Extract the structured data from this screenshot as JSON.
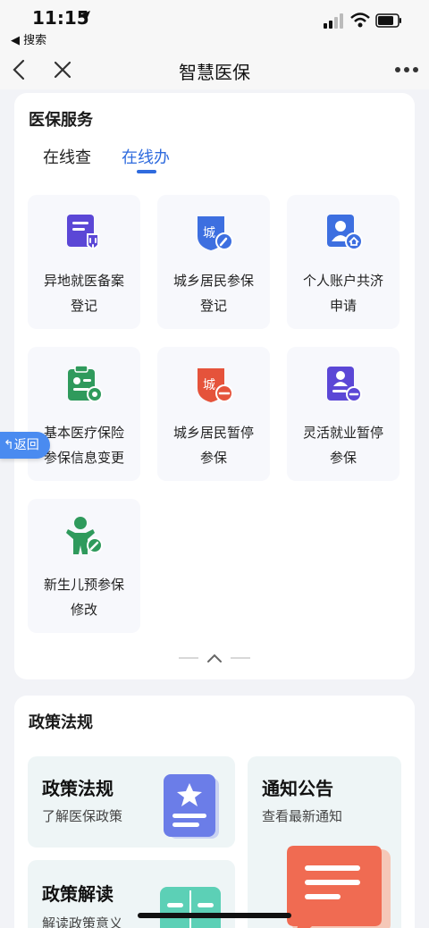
{
  "status_bar": {
    "time": "11:15",
    "back_app": "◀ 搜索"
  },
  "nav": {
    "title": "智慧医保"
  },
  "service": {
    "title": "医保服务",
    "tabs": [
      {
        "label": "在线查"
      },
      {
        "label": "在线办"
      }
    ],
    "tiles": [
      {
        "line1": "异地就医备案",
        "line2": "登记"
      },
      {
        "line1": "城乡居民参保",
        "line2": "登记"
      },
      {
        "line1": "个人账户共济",
        "line2": "申请"
      },
      {
        "line1": "基本医疗保险",
        "line2": "参保信息变更"
      },
      {
        "line1": "城乡居民暂停",
        "line2": "参保"
      },
      {
        "line1": "灵活就业暂停",
        "line2": "参保"
      },
      {
        "line1": "新生儿预参保",
        "line2": "修改"
      }
    ]
  },
  "policy": {
    "title": "政策法规",
    "blocks": [
      {
        "title": "政策法规",
        "subtitle": "了解医保政策"
      },
      {
        "title": "通知公告",
        "subtitle": "查看最新通知"
      },
      {
        "title": "政策解读",
        "subtitle": "解读政策意义"
      }
    ]
  },
  "side_back": {
    "label": "返回"
  },
  "colors": {
    "accent": "#2f6bde",
    "purple": "#5b47d6",
    "blue": "#3d6fe0",
    "green": "#2f9a5c",
    "red": "#e5533b"
  }
}
